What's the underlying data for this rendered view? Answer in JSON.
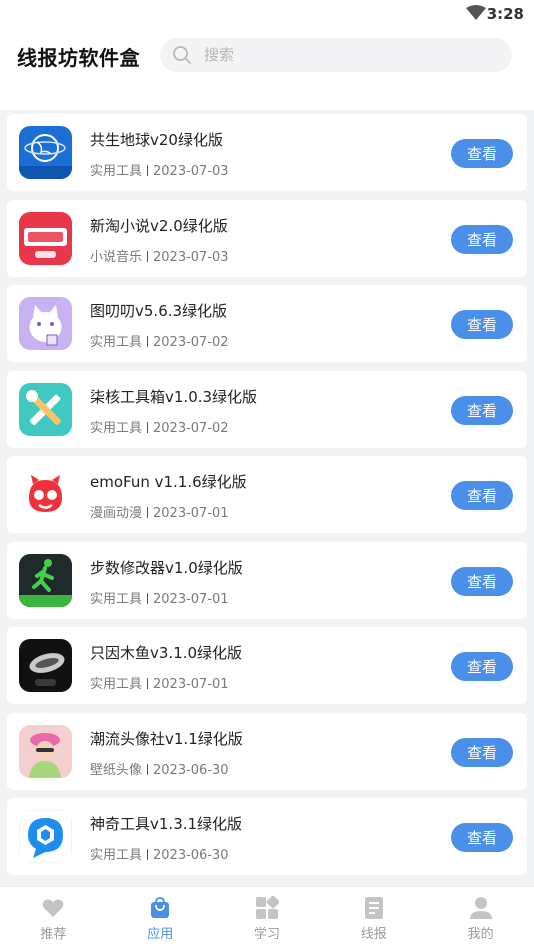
{
  "status_bar": {
    "time": "3:28"
  },
  "header": {
    "title": "线报坊软件盒"
  },
  "search": {
    "placeholder": "搜索"
  },
  "apps": [
    {
      "name": "共生地球v20绿化版",
      "category": "实用工具",
      "date": "2023-07-03",
      "action": "查看",
      "icon": "globe-app-icon"
    },
    {
      "name": "新淘小说v2.0绿化版",
      "category": "小说音乐",
      "date": "2023-07-03",
      "action": "查看",
      "icon": "novel-app-icon"
    },
    {
      "name": "图叨叨v5.6.3绿化版",
      "category": "实用工具",
      "date": "2023-07-02",
      "action": "查看",
      "icon": "cat-app-icon"
    },
    {
      "name": "柒核工具箱v1.0.3绿化版",
      "category": "实用工具",
      "date": "2023-07-02",
      "action": "查看",
      "icon": "toolbox-app-icon"
    },
    {
      "name": "emoFun v1.1.6绿化版",
      "category": "漫画动漫",
      "date": "2023-07-01",
      "action": "查看",
      "icon": "emofun-app-icon"
    },
    {
      "name": "步数修改器v1.0绿化版",
      "category": "实用工具",
      "date": "2023-07-01",
      "action": "查看",
      "icon": "walker-app-icon"
    },
    {
      "name": "只因木鱼v3.1.0绿化版",
      "category": "实用工具",
      "date": "2023-07-01",
      "action": "查看",
      "icon": "wooden-fish-app-icon"
    },
    {
      "name": "潮流头像社v1.1绿化版",
      "category": "壁纸头像",
      "date": "2023-06-30",
      "action": "查看",
      "icon": "avatar-app-icon"
    },
    {
      "name": "神奇工具v1.3.1绿化版",
      "category": "实用工具",
      "date": "2023-06-30",
      "action": "查看",
      "icon": "cube-app-icon"
    }
  ],
  "tabs": [
    {
      "label": "推荐",
      "icon": "heart-icon",
      "active": false
    },
    {
      "label": "应用",
      "icon": "bag-icon",
      "active": true
    },
    {
      "label": "学习",
      "icon": "grid-icon",
      "active": false
    },
    {
      "label": "线报",
      "icon": "document-icon",
      "active": false
    },
    {
      "label": "我的",
      "icon": "person-icon",
      "active": false
    }
  ],
  "colors": {
    "accent": "#4a90e8",
    "inactive": "#9a9a9a",
    "background": "#f1f2f4"
  }
}
